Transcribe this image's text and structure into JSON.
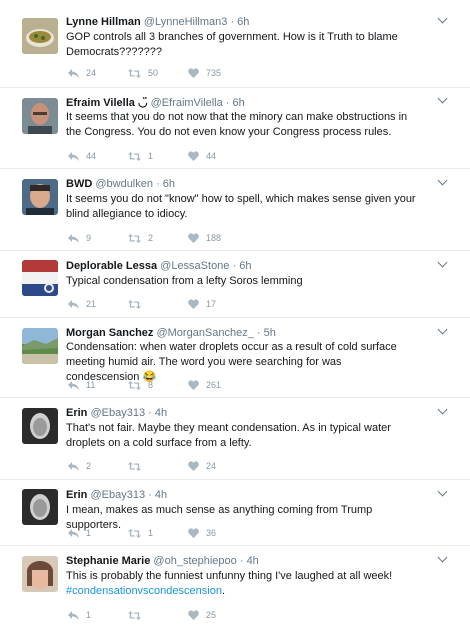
{
  "tweets": [
    {
      "name": "Lynne Hillman",
      "handle": "@LynneHillman3",
      "time": "6h",
      "text": "GOP controls all 3 branches of government. How is it Truth to blame Democrats???????",
      "replies": "24",
      "retweets": "50",
      "likes": "735"
    },
    {
      "name": "Efraim Vilella ◡̈",
      "handle": "@EfraimVilella",
      "time": "6h",
      "text": "It seems that you do not now that the minory can make obstructions in the Congress. You do not even know your Congress process rules.",
      "replies": "44",
      "retweets": "1",
      "likes": "44"
    },
    {
      "name": "BWD",
      "handle": "@bwdulken",
      "time": "6h",
      "text": "It seems you do not \"know\" how to spell, which makes sense given your blind allegiance to idiocy.",
      "replies": "9",
      "retweets": "2",
      "likes": "188"
    },
    {
      "name": "Deplorable Lessa",
      "handle": "@LessaStone",
      "time": "6h",
      "text": "Typical condensation from a lefty Soros lemming",
      "replies": "21",
      "retweets": "",
      "likes": "17"
    },
    {
      "name": "Morgan Sanchez",
      "handle": "@MorganSanchez_",
      "time": "5h",
      "text": "Condensation: when water droplets occur as a result of cold surface meeting humid air. The word you were searching for was condescension 😂",
      "replies": "11",
      "retweets": "8",
      "likes": "261"
    },
    {
      "name": "Erin",
      "handle": "@Ebay313",
      "time": "4h",
      "text": "That's not fair.  Maybe they meant condensation.  As in typical water droplets on a cold surface from a lefty.",
      "replies": "2",
      "retweets": "",
      "likes": "24"
    },
    {
      "name": "Erin",
      "handle": "@Ebay313",
      "time": "4h",
      "text": "I mean, makes as much sense as anything coming from Trump supporters.",
      "replies": "1",
      "retweets": "1",
      "likes": "36"
    },
    {
      "name": "Stephanie Marie",
      "handle": "@oh_stephiepoo",
      "time": "4h",
      "text": "This is probably the funniest unfunny thing I've laughed at all week!",
      "hashtag": "#condensationvscondescension",
      "hashtag_suffix": ".",
      "replies": "1",
      "retweets": "",
      "likes": "25"
    }
  ]
}
